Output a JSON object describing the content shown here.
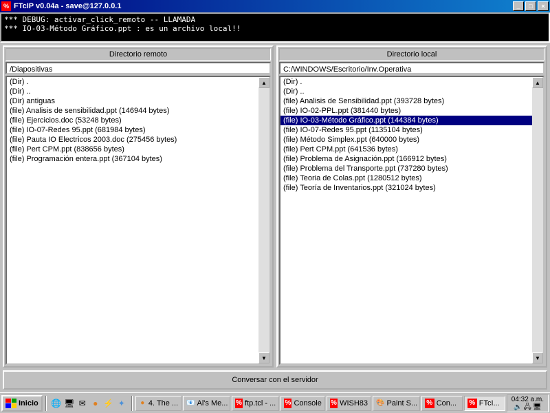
{
  "title": "FTcIP v0.04a - save@127.0.0.1",
  "debug_lines": [
    "*** DEBUG: activar_click_remoto -- LLAMADA",
    "*** IO-03-Método Gráfico.ppt : es un archivo local!!"
  ],
  "remote": {
    "header": "Directorio remoto",
    "path": "/Diapositivas",
    "items": [
      {
        "t": "(Dir) ."
      },
      {
        "t": "(Dir) .."
      },
      {
        "t": "(Dir) antiguas"
      },
      {
        "t": "(file) Analisis de sensibilidad.ppt (146944 bytes)"
      },
      {
        "t": "(file) Ejercicios.doc (53248 bytes)"
      },
      {
        "t": "(file) IO-07-Redes 95.ppt (681984 bytes)"
      },
      {
        "t": "(file) Pauta IO Electricos 2003.doc (275456 bytes)"
      },
      {
        "t": "(file) Pert CPM.ppt (838656 bytes)"
      },
      {
        "t": "(file) Programación entera.ppt (367104 bytes)"
      }
    ]
  },
  "local": {
    "header": "Directorio local",
    "path": "C:/WINDOWS/Escritorio/Inv.Operativa",
    "items": [
      {
        "t": "(Dir) ."
      },
      {
        "t": "(Dir) .."
      },
      {
        "t": "(file) Analisis de Sensibilidad.ppt (393728 bytes)"
      },
      {
        "t": "(file) IO-02-PPL.ppt (381440 bytes)"
      },
      {
        "t": "(file) IO-03-Método Gráfico.ppt (144384 bytes)",
        "sel": true
      },
      {
        "t": "(file) IO-07-Redes 95.ppt (1135104 bytes)"
      },
      {
        "t": "(file) Método Simplex.ppt (640000 bytes)"
      },
      {
        "t": "(file) Pert CPM.ppt (641536 bytes)"
      },
      {
        "t": "(file) Problema de Asignación.ppt (166912 bytes)"
      },
      {
        "t": "(file) Problema del Transporte.ppt (737280 bytes)"
      },
      {
        "t": "(file) Teoria de Colas.ppt (1280512 bytes)"
      },
      {
        "t": "(file) Teoría de Inventarios.ppt (321024 bytes)"
      }
    ]
  },
  "converse": "Conversar con el servidor",
  "taskbar": {
    "start": "Inicio",
    "tasks": [
      {
        "label": "4. The ...",
        "active": false
      },
      {
        "label": "Al's Me...",
        "active": false
      },
      {
        "label": "ftp.tcl - ...",
        "active": false
      },
      {
        "label": "Console",
        "active": false
      },
      {
        "label": "WISH83",
        "active": false
      },
      {
        "label": "Paint S...",
        "active": false
      },
      {
        "label": "Con...",
        "active": false
      },
      {
        "label": "FTcI...",
        "active": true
      }
    ],
    "time": "04:32 a.m.",
    "date": ""
  }
}
